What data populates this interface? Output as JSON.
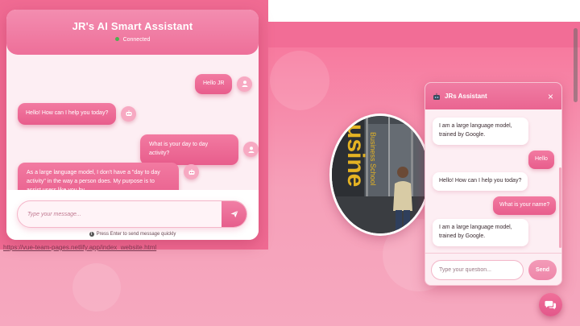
{
  "left_chat": {
    "title": "JR's AI Smart Assistant",
    "status": "Connected",
    "messages": [
      {
        "from": "user",
        "text": "Hello JR"
      },
      {
        "from": "bot",
        "text": "Hello! How can I help you today?"
      },
      {
        "from": "user",
        "text": "What is your day to day activity?"
      },
      {
        "from": "bot",
        "text": "As a large language model, I don't have a \"day to day activity\" in the way a person does. My purpose is to assist users like you by"
      }
    ],
    "input_placeholder": "Type your message...",
    "hint": "Press Enter to send message quickly"
  },
  "background": {
    "link_text": "https://vue-team-pages.netlify.app/index_website.html"
  },
  "widget": {
    "title": "JRs Assistant",
    "close_glyph": "×",
    "messages": [
      {
        "from": "bot",
        "text": "I am a large language model, trained by Google."
      },
      {
        "from": "user",
        "text": "Hello"
      },
      {
        "from": "bot",
        "text": "Hello! How can I help you today?"
      },
      {
        "from": "user",
        "text": "What is your name?"
      },
      {
        "from": "bot",
        "text": "I am a large language model, trained by Google."
      }
    ],
    "input_placeholder": "Type your question...",
    "send_label": "Send"
  },
  "profile": {
    "sign_text": "Business School",
    "sign_big": "usine"
  },
  "icons": {
    "user_avatar": "user-icon",
    "bot_avatar": "robot-icon",
    "send": "paper-plane-icon",
    "info": "info-icon",
    "fab": "chat-bubbles-icon"
  },
  "colors": {
    "accent": "#ec6a95",
    "accent_dark": "#e3578a",
    "panel_bg": "#fdeef3",
    "status_dot": "#4caf50"
  }
}
